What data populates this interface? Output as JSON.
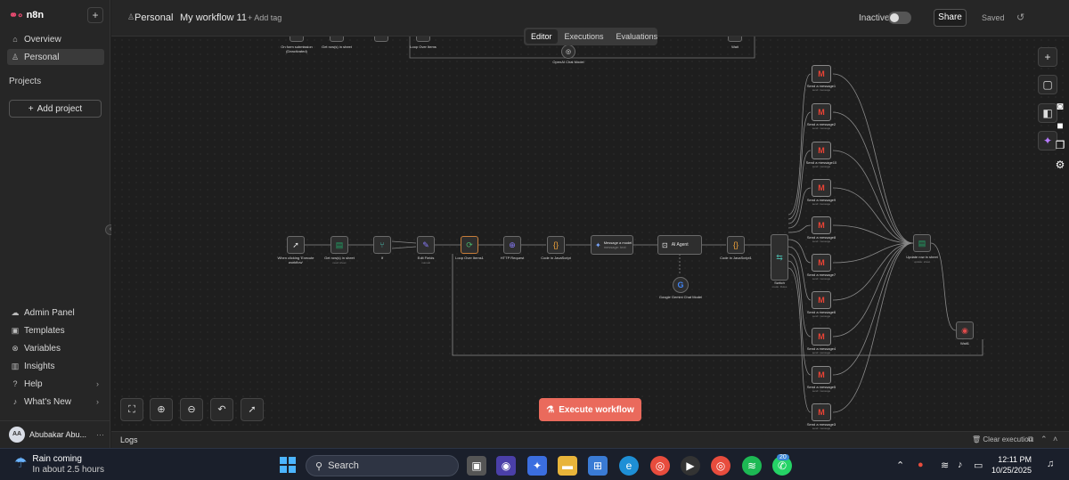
{
  "sidebar": {
    "brand": "n8n",
    "items": [
      {
        "label": "Overview"
      },
      {
        "label": "Personal"
      }
    ],
    "projects_label": "Projects",
    "add_project": "Add project",
    "bottom_items": [
      {
        "label": "Admin Panel"
      },
      {
        "label": "Templates"
      },
      {
        "label": "Variables"
      },
      {
        "label": "Insights"
      },
      {
        "label": "Help"
      },
      {
        "label": "What's New"
      }
    ],
    "user": {
      "initials": "AA",
      "name": "Abubakar Abu..."
    }
  },
  "header": {
    "project": "Personal",
    "workflow_name": "My workflow 11",
    "add_tag": "+ Add tag",
    "status_label": "Inactive",
    "share": "Share",
    "saved": "Saved"
  },
  "tabs": [
    {
      "label": "Editor"
    },
    {
      "label": "Executions"
    },
    {
      "label": "Evaluations"
    }
  ],
  "nodes": {
    "top_form": "On form submission (Deactivated)",
    "top_get_rows": "Get row(s) in sheet",
    "top_loop": "Loop Over Items",
    "top_wait": "Wait",
    "top_openai": "OpenAI Chat Model",
    "trigger": "When clicking 'Execute workflow'",
    "get_rows": "Get row(s) in sheet",
    "get_rows_sub": "read: sheet",
    "if": "If",
    "edit_fields": "Edit Fields",
    "edit_fields_sub": "manual",
    "loop": "Loop Over Items1",
    "http": "HTTP Request",
    "code1": "Code in JavaScript",
    "message_model": "Message a model",
    "message_model_sub": "message: text",
    "ai_agent": "AI Agent",
    "gemini": "Google Gemini Chat Model",
    "code2": "Code in JavaScript1",
    "switch": "Switch",
    "switch_sub": "mode: Rules",
    "update_rows": "Update row in sheet",
    "update_rows_sub": "update: sheet",
    "wait1": "Wait1",
    "send_messages": [
      "Send a message1",
      "Send a message2",
      "Send a message10",
      "Send a message9",
      "Send a message8",
      "Send a message7",
      "Send a message6",
      "Send a message4",
      "Send a message5",
      "Send a message3"
    ],
    "send_sub": "send: message"
  },
  "execute_button": "Execute workflow",
  "logs": {
    "label": "Logs",
    "clear": "Clear execution"
  },
  "taskbar": {
    "weather_title": "Rain coming",
    "weather_sub": "In about 2.5 hours",
    "search": "Search",
    "time": "12:11 PM",
    "date": "10/25/2025",
    "whatsapp_badge": "20"
  }
}
